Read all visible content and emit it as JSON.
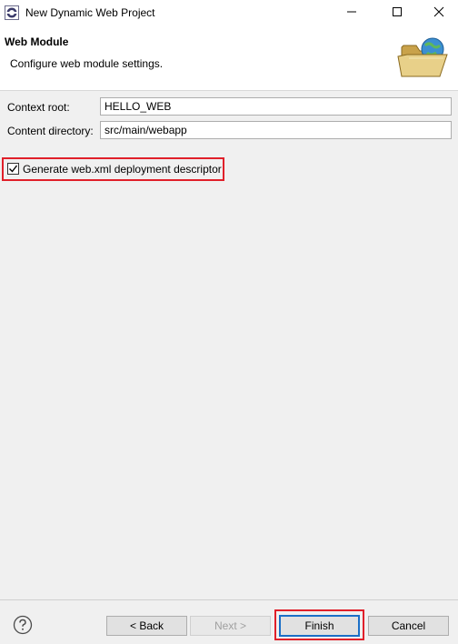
{
  "window": {
    "title": "New Dynamic Web Project",
    "icons": {
      "app": "eclipse-icon",
      "minimize": "minimize-icon",
      "maximize": "maximize-icon",
      "close": "close-icon"
    }
  },
  "header": {
    "title": "Web Module",
    "description": "Configure web module settings.",
    "icon": "folder-globe-icon"
  },
  "form": {
    "context_root": {
      "label": "Context root:",
      "value": "HELLO_WEB"
    },
    "content_directory": {
      "label": "Content directory:",
      "value": "src/main/webapp"
    },
    "generate_descriptor": {
      "label": "Generate web.xml deployment descriptor",
      "checked": true
    }
  },
  "footer": {
    "help_icon": "help-icon",
    "buttons": {
      "back": "< Back",
      "next": "Next >",
      "finish": "Finish",
      "cancel": "Cancel"
    }
  },
  "colors": {
    "highlight": "#e0202a",
    "focus": "#1b6fc7",
    "background": "#f0f0f0"
  }
}
